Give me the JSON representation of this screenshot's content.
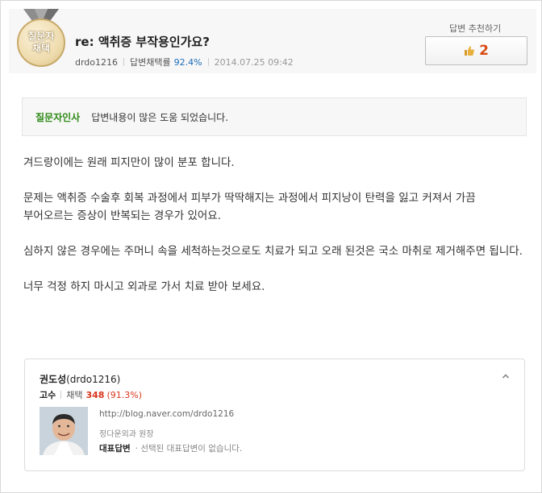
{
  "header": {
    "badge_line1": "질문자",
    "badge_line2": "채택",
    "title_prefix": "re:",
    "title": "액취증 부작용인가요?",
    "author_id": "drdo1216",
    "adoption_label": "답변채택률",
    "adoption_rate": "92.4%",
    "date": "2014.07.25 09:42",
    "recommend_label": "답변 추천하기",
    "recommend_count": "2"
  },
  "thanks": {
    "label": "질문자인사",
    "text": "답변내용이 많은 도움 되었습니다."
  },
  "answer": {
    "paragraphs": [
      "겨드랑이에는 원래 피지만이 많이 분포 합니다.",
      "문제는 액취증 수술후 회복 과정에서 피부가 딱딱해지는 과정에서 피지낭이 탄력을 잃고 커져서 가끔 부어오르는 증상이 반복되는 경우가 있어요.",
      "심하지 않은 경우에는 주머니 속을 세척하는것으로도 치료가 되고 오래 된것은 국소 마취로 제거해주면 됩니다.",
      "너무 걱정 하지 마시고 외과로 가서 치료 받아 보세요."
    ]
  },
  "profile": {
    "name": "권도성",
    "id": "(drdo1216)",
    "level": "고수",
    "adopt_label": "채택",
    "adopt_count": "348",
    "adopt_pct": "(91.3%)",
    "blog_url": "http://blog.naver.com/drdo1216",
    "org": "정다운외과 원장",
    "rep_label": "대표답변",
    "rep_value": "· 선택된 대표답변이 없습니다."
  },
  "colors": {
    "accent_green": "#2e8a16",
    "recommend_count": "#d84a13",
    "rate_blue": "#1d6cb8",
    "adopt_red": "#d9351c"
  }
}
